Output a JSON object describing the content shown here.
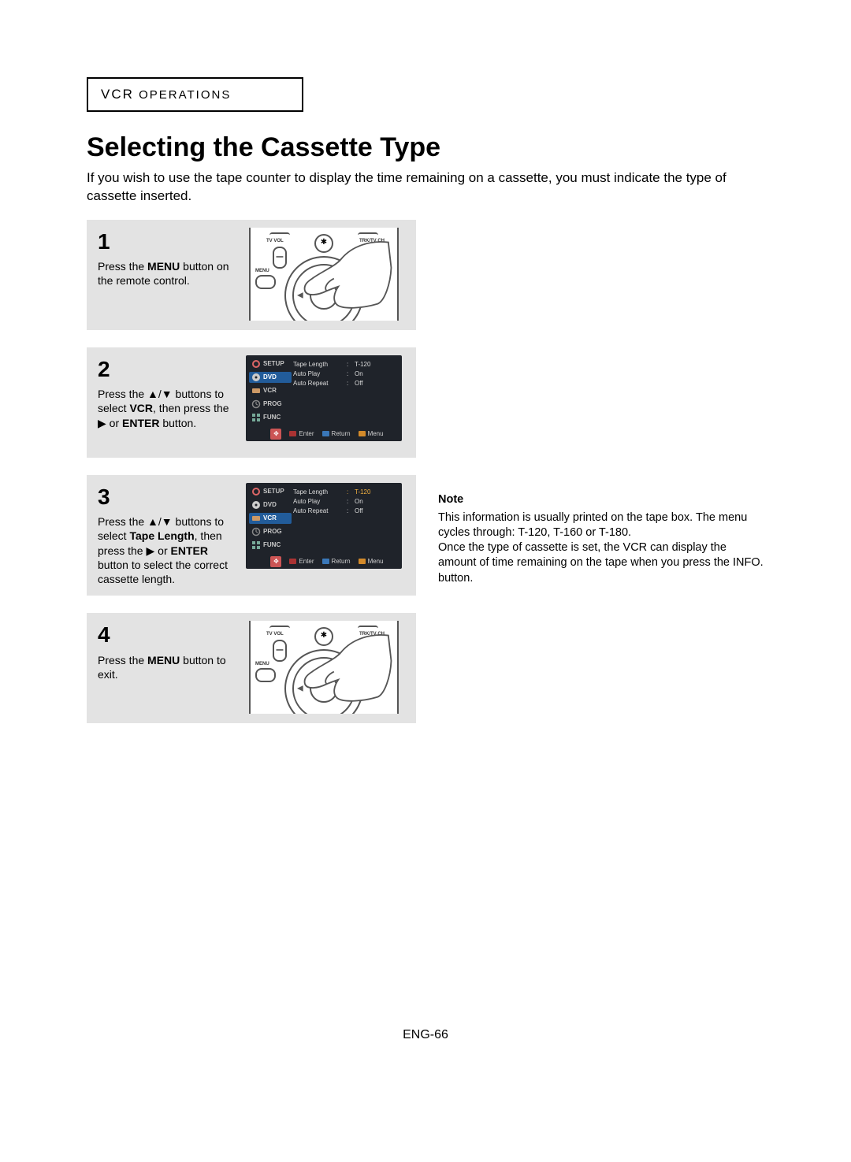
{
  "section": {
    "prefix": "VCR",
    "word": " O",
    "rest": "PERATIONS"
  },
  "title": "Selecting the Cassette Type",
  "intro": "If you wish to use the tape counter to display the time remaining on a cassette, you must indicate the type of cassette inserted.",
  "steps": {
    "s1": {
      "num": "1",
      "text_before": "Press the ",
      "b1": "MENU",
      "text_after": " button on the remote control."
    },
    "s2": {
      "num": "2",
      "t1": "Press the ",
      "t2": " buttons to select ",
      "b1": "VCR",
      "t3": ", then press the ",
      "t4": " or ",
      "b2": "ENTER",
      "t5": " button."
    },
    "s3": {
      "num": "3",
      "t1": "Press the ",
      "t2": " buttons to select ",
      "b1": "Tape Length",
      "t3": ", then press the ",
      "t4": " or ",
      "b2": "ENTER",
      "t5": " button to select the correct cassette length."
    },
    "s4": {
      "num": "4",
      "t1": "Press the ",
      "b1": "MENU",
      "t2": " button to exit."
    }
  },
  "remote": {
    "tvvol": "TV VOL",
    "trk": "TRK/TV CH",
    "menu": "MENU",
    "mute": "✱",
    "minus": "–"
  },
  "osd": {
    "side": [
      "SETUP",
      "DVD",
      "VCR",
      "PROG",
      "FUNC"
    ],
    "rows": [
      {
        "k": "Tape Length",
        "v": "T-120"
      },
      {
        "k": "Auto Play",
        "v": "On"
      },
      {
        "k": "Auto Repeat",
        "v": "Off"
      }
    ],
    "hints": {
      "enter": "Enter",
      "return": "Return",
      "menu": "Menu"
    }
  },
  "note": {
    "title": "Note",
    "p1": "This information is usually printed on the tape box. The menu cycles through: T-120, T-160 or T-180.",
    "p2": "Once the type of cassette is set, the VCR can display the amount of time remaining on the tape when you press the INFO. button."
  },
  "page_num": "ENG-66"
}
